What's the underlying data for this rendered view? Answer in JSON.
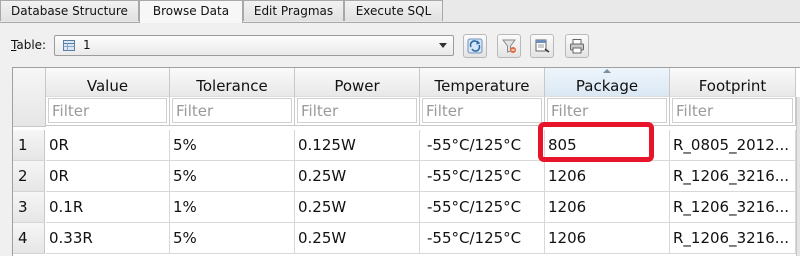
{
  "tabs": [
    "Database Structure",
    "Browse Data",
    "Edit Pragmas",
    "Execute SQL"
  ],
  "active_tab": "Browse Data",
  "toolbar": {
    "table_label_mnemonic": "T",
    "table_label_rest": "able:",
    "table_value": "1",
    "buttons": [
      "refresh-icon",
      "clear-filters-icon",
      "print-preview-icon",
      "print-icon"
    ]
  },
  "grid": {
    "columns": [
      "Value",
      "Tolerance",
      "Power",
      "Temperature",
      "Package",
      "Footprint"
    ],
    "sorted_column": "Package",
    "filter_placeholder": "Filter",
    "rows": [
      {
        "num": "1",
        "cells": [
          "0R",
          "5%",
          "0.125W",
          "-55°C/125°C",
          "805",
          "R_0805_2012..."
        ]
      },
      {
        "num": "2",
        "cells": [
          "0R",
          "5%",
          "0.25W",
          "-55°C/125°C",
          "1206",
          "R_1206_3216..."
        ]
      },
      {
        "num": "3",
        "cells": [
          "0.1R",
          "1%",
          "0.25W",
          "-55°C/125°C",
          "1206",
          "R_1206_3216..."
        ]
      },
      {
        "num": "4",
        "cells": [
          "0.33R",
          "5%",
          "0.25W",
          "-55°C/125°C",
          "1206",
          "R_1206_3216..."
        ]
      }
    ],
    "highlight_color": "#e8142a"
  }
}
